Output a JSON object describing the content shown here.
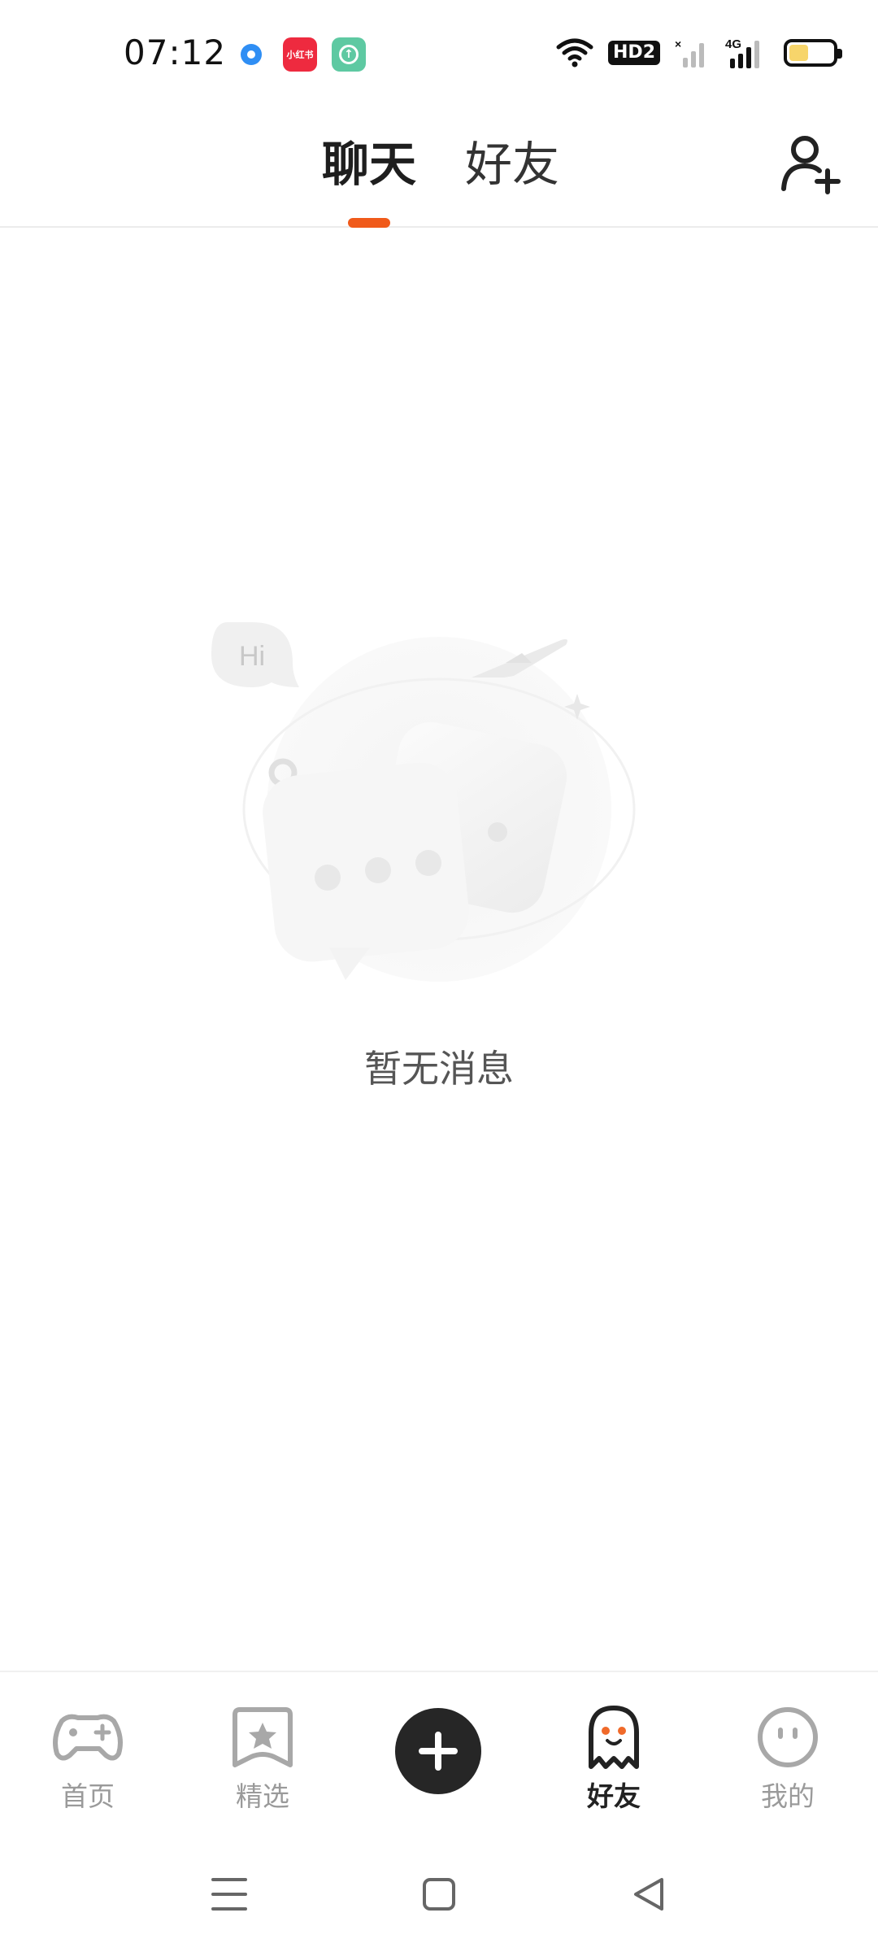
{
  "status_bar": {
    "time": "07:12",
    "notification_icons": [
      "browser-icon",
      "xiaohongshu-icon",
      "upload-icon"
    ],
    "xiaohongshu_label": "小红书",
    "network": "4G",
    "hd_label": "HD2",
    "battery_level": 0.45,
    "battery_color": "#f7d56b"
  },
  "header": {
    "tabs": [
      {
        "label": "聊天",
        "active": true
      },
      {
        "label": "好友",
        "active": false
      }
    ],
    "accent_color": "#f05a1a"
  },
  "empty_state": {
    "bubble_text": "Hi",
    "message": "暂无消息"
  },
  "bottom_nav": {
    "items": [
      {
        "label": "首页",
        "icon": "gamepad-icon",
        "active": false
      },
      {
        "label": "精选",
        "icon": "star-bookmark-icon",
        "active": false
      },
      {
        "label": "",
        "icon": "plus-icon",
        "active": false
      },
      {
        "label": "好友",
        "icon": "ghost-icon",
        "active": true
      },
      {
        "label": "我的",
        "icon": "face-icon",
        "active": false
      }
    ]
  },
  "system_nav": {
    "buttons": [
      "menu-icon",
      "home-square-icon",
      "back-triangle-icon"
    ]
  }
}
